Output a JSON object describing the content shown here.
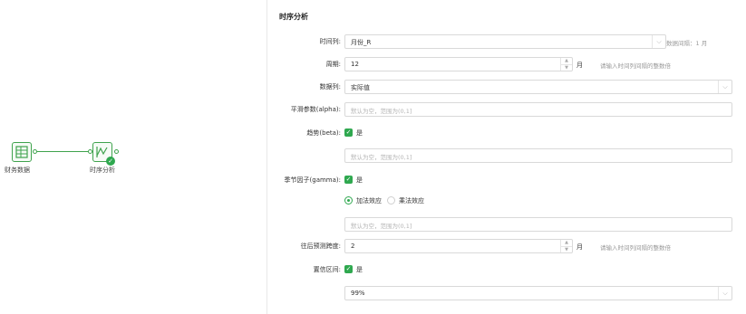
{
  "canvas": {
    "node1": {
      "label": "财务数据",
      "icon": "table-icon"
    },
    "node2": {
      "label": "时序分析",
      "icon": "time-series-icon",
      "status": "✓"
    }
  },
  "panel": {
    "title": "时序分析",
    "time_column": {
      "label": "时间列:",
      "value": "月份_R",
      "interval_note": "数据间隔：1 月"
    },
    "period": {
      "label": "周期:",
      "value": "12",
      "unit": "月",
      "hint": "请输入时间列间隔的整数倍"
    },
    "data_column": {
      "label": "数据列:",
      "value": "实际值"
    },
    "alpha": {
      "label": "平滑参数(alpha):",
      "placeholder": "默认为空，范围为(0,1]"
    },
    "beta": {
      "label": "趋势(beta):",
      "checkbox_text": "是",
      "placeholder": "默认为空，范围为(0,1]"
    },
    "gamma": {
      "label": "季节因子(gamma):",
      "checkbox_text": "是",
      "options": [
        "加法效应",
        "乘法效应"
      ],
      "selected": "加法效应",
      "placeholder": "默认为空，范围为(0,1]"
    },
    "forecast": {
      "label": "往后预测跨度:",
      "value": "2",
      "unit": "月",
      "hint": "请输入时间列间隔的整数倍"
    },
    "confidence": {
      "label": "置信区间:",
      "checkbox_text": "是",
      "value": "99%"
    }
  }
}
